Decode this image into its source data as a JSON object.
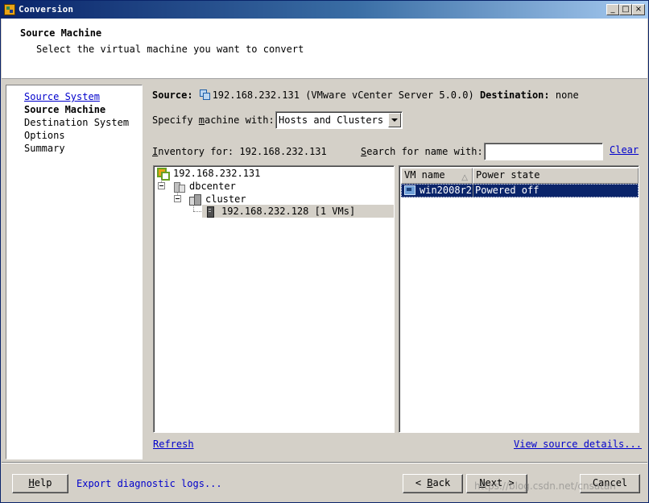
{
  "window": {
    "title": "Conversion",
    "controls": {
      "minimize": "_",
      "maximize": "□",
      "close": "×"
    }
  },
  "header": {
    "title": "Source Machine",
    "subtitle": "Select the virtual machine you want to convert"
  },
  "sidebar": {
    "items": [
      {
        "label": "Source System",
        "state": "link"
      },
      {
        "label": "Source Machine",
        "state": "current"
      },
      {
        "label": "Destination System",
        "state": "normal"
      },
      {
        "label": "Options",
        "state": "normal"
      },
      {
        "label": "Summary",
        "state": "normal"
      }
    ]
  },
  "source": {
    "label": "Source:",
    "host": "192.168.232.131",
    "product": "(VMware vCenter Server 5.0.0)",
    "dest_label": "Destination:",
    "dest_value": "none",
    "icon": "vcenter-icon"
  },
  "specify": {
    "label_pre": "Specify ",
    "label_mn": "m",
    "label_post": "achine with:",
    "selected": "Hosts and Clusters"
  },
  "inventory": {
    "label_mn": "I",
    "label_post": "nventory for: 192.168.232.131"
  },
  "search": {
    "label_mn": "S",
    "label_post": "earch for name with:",
    "value": "",
    "clear_label": "Clear"
  },
  "tree": {
    "nodes": [
      {
        "label": "192.168.232.131",
        "icon": "vcenter-icon"
      },
      {
        "label": "dbcenter",
        "icon": "datacenter-icon"
      },
      {
        "label": "cluster",
        "icon": "cluster-icon"
      },
      {
        "label": "192.168.232.128 [1 VMs]",
        "icon": "host-icon"
      }
    ]
  },
  "vmlist": {
    "columns": [
      "VM name",
      "Power state"
    ],
    "rows": [
      {
        "name": "win2008r2",
        "state": "Powered off",
        "icon": "vm-icon"
      }
    ]
  },
  "links": {
    "refresh": "Refresh",
    "view_details": "View source details...",
    "export_logs": "Export diagnostic logs..."
  },
  "buttons": {
    "help": {
      "mn": "H",
      "rest": "elp"
    },
    "back": {
      "pre": "< ",
      "mn": "B",
      "rest": "ack"
    },
    "next": {
      "mn": "N",
      "rest": "ext >"
    },
    "cancel": "Cancel"
  },
  "watermark": "https://blog.csdn.net/cnsatan"
}
